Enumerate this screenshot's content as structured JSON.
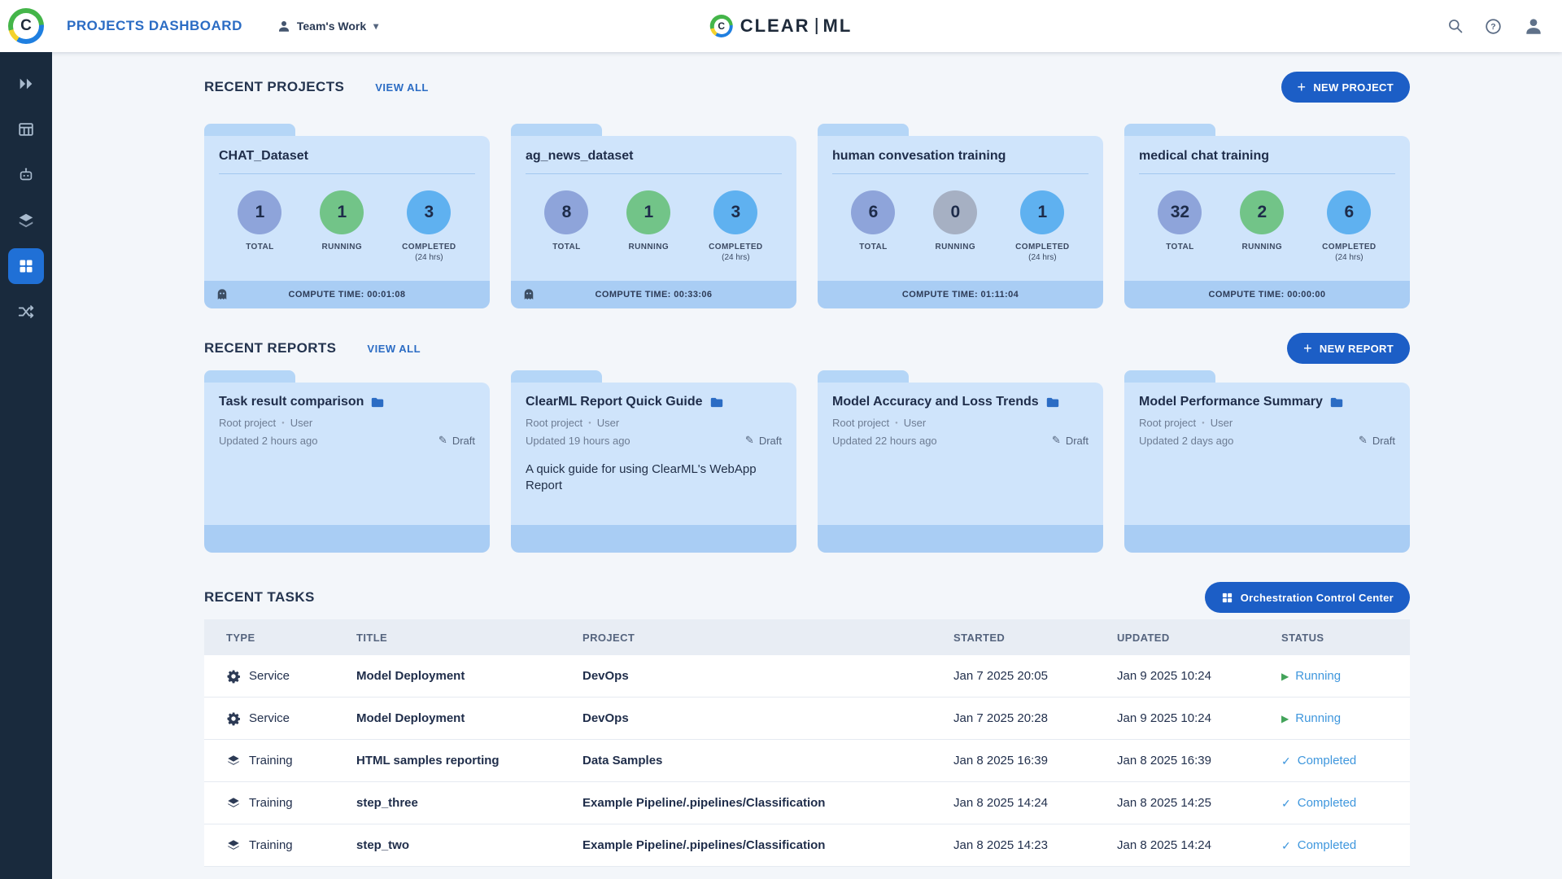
{
  "colors": {
    "accent_blue": "#2b6cc4",
    "button_blue": "#1c5ec6",
    "sidebar_bg": "#192a3d",
    "sidebar_active": "#2070d6",
    "card_body": "#cfe4fb",
    "card_tab": "#b5d6f7",
    "card_footer": "#a9cdf4",
    "total_circle": "#8ea4da",
    "running_circle": "#72c488",
    "running_zero_circle": "#a6b0c3",
    "completed_circle": "#5fb1f0",
    "status_blue": "#3f97dd",
    "status_green": "#43a35a"
  },
  "icons": {
    "plus": "+",
    "pencil": "✎",
    "check": "✓",
    "play": "▶",
    "caret_down": "▾",
    "dot": "●"
  },
  "header": {
    "page_title": "PROJECTS DASHBOARD",
    "workspace_label": "Team's Work",
    "logo_c": "C",
    "logo_clear": "CLEAR",
    "logo_ml": "ML"
  },
  "projects_section": {
    "title": "RECENT PROJECTS",
    "view_all": "VIEW ALL",
    "new_project_label": "NEW PROJECT",
    "stat_labels": {
      "total": "TOTAL",
      "running": "RUNNING",
      "completed": "COMPLETED",
      "period": "(24 hrs)"
    },
    "cards": [
      {
        "name": "CHAT_Dataset",
        "total": "1",
        "running": "1",
        "completed": "3",
        "compute_time": "COMPUTE TIME: 00:01:08"
      },
      {
        "name": "ag_news_dataset",
        "total": "8",
        "running": "1",
        "completed": "3",
        "compute_time": "COMPUTE TIME: 00:33:06"
      },
      {
        "name": "human convesation training",
        "total": "6",
        "running": "0",
        "completed": "1",
        "compute_time": "COMPUTE TIME: 01:11:04"
      },
      {
        "name": "medical chat training",
        "total": "32",
        "running": "2",
        "completed": "6",
        "compute_time": "COMPUTE TIME: 00:00:00"
      }
    ]
  },
  "reports_section": {
    "title": "RECENT REPORTS",
    "view_all": "VIEW ALL",
    "new_report_label": "NEW REPORT",
    "cards": [
      {
        "title": "Task result comparison",
        "project": "Root project",
        "user": "User",
        "updated": "Updated 2 hours ago",
        "status": "Draft",
        "description": ""
      },
      {
        "title": "ClearML Report Quick Guide",
        "project": "Root project",
        "user": "User",
        "updated": "Updated 19 hours ago",
        "status": "Draft",
        "description": "A quick guide for using ClearML's WebApp Report"
      },
      {
        "title": "Model Accuracy and Loss Trends",
        "project": "Root project",
        "user": "User",
        "updated": "Updated 22 hours ago",
        "status": "Draft",
        "description": ""
      },
      {
        "title": "Model Performance Summary",
        "project": "Root project",
        "user": "User",
        "updated": "Updated 2 days ago",
        "status": "Draft",
        "description": ""
      }
    ]
  },
  "tasks_section": {
    "title": "RECENT TASKS",
    "orchestration_button": "Orchestration Control Center",
    "columns": [
      "TYPE",
      "TITLE",
      "PROJECT",
      "STARTED",
      "UPDATED",
      "STATUS"
    ],
    "rows": [
      {
        "type": "Service",
        "title": "Model Deployment",
        "project": "DevOps",
        "started": "Jan 7 2025 20:05",
        "updated": "Jan 9 2025 10:24",
        "status": "Running"
      },
      {
        "type": "Service",
        "title": "Model Deployment",
        "project": "DevOps",
        "started": "Jan 7 2025 20:28",
        "updated": "Jan 9 2025 10:24",
        "status": "Running"
      },
      {
        "type": "Training",
        "title": "HTML samples reporting",
        "project": "Data Samples",
        "started": "Jan 8 2025 16:39",
        "updated": "Jan 8 2025 16:39",
        "status": "Completed"
      },
      {
        "type": "Training",
        "title": "step_three",
        "project": "Example Pipeline/.pipelines/Classification",
        "started": "Jan 8 2025 14:24",
        "updated": "Jan 8 2025 14:25",
        "status": "Completed"
      },
      {
        "type": "Training",
        "title": "step_two",
        "project": "Example Pipeline/.pipelines/Classification",
        "started": "Jan 8 2025 14:23",
        "updated": "Jan 8 2025 14:24",
        "status": "Completed"
      }
    ]
  }
}
